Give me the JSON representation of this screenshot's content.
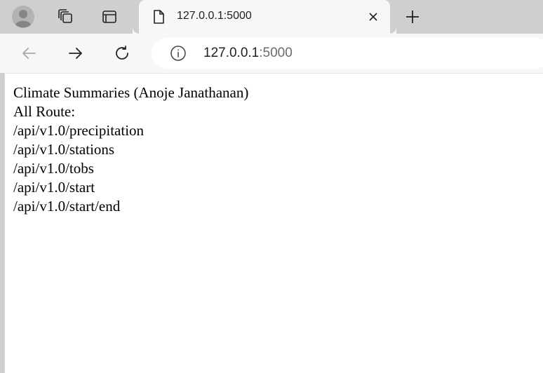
{
  "tab": {
    "title": "127.0.0.1:5000"
  },
  "address_bar": {
    "host": "127.0.0.1",
    "port": ":5000"
  },
  "page": {
    "heading": "Climate Summaries (Anoje Janathanan)",
    "routes_label": "All Route:",
    "routes": [
      "/api/v1.0/precipitation",
      "/api/v1.0/stations",
      "/api/v1.0/tobs",
      "/api/v1.0/start",
      "/api/v1.0/start/end"
    ]
  },
  "icons": {
    "profile": "profile-icon",
    "collections": "collections-icon",
    "tab_actions": "tab-actions-icon",
    "page": "page-icon",
    "close": "close-icon",
    "new_tab": "plus-icon",
    "back": "back-arrow-icon",
    "forward": "forward-arrow-icon",
    "refresh": "refresh-icon",
    "info": "info-icon"
  },
  "colors": {
    "tabstrip": "#cfcfcf",
    "toolbar": "#f7f7f7",
    "page_background": "#ffffff",
    "text": "#000000"
  }
}
